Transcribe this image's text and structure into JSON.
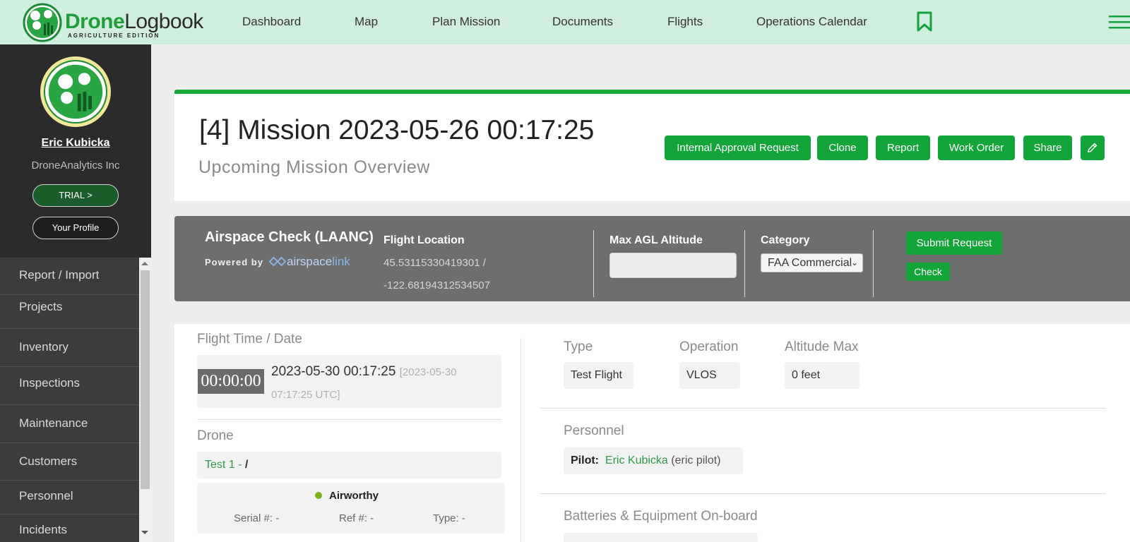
{
  "brand": {
    "name_bold": "Drone",
    "name_light": "Logbook",
    "edition": "AGRICULTURE EDITION"
  },
  "nav": {
    "dashboard": "Dashboard",
    "map": "Map",
    "plan_mission": "Plan Mission",
    "documents": "Documents",
    "flights": "Flights",
    "operations_calendar": "Operations Calendar"
  },
  "user": {
    "name": "Eric Kubicka",
    "company": "DroneAnalytics Inc",
    "trial_label": "TRIAL >",
    "profile_label": "Your Profile"
  },
  "sidebar": {
    "items": [
      {
        "label": "Report / Import"
      },
      {
        "label": "Projects"
      },
      {
        "label": "Inventory"
      },
      {
        "label": "Inspections"
      },
      {
        "label": "Maintenance"
      },
      {
        "label": "Customers"
      },
      {
        "label": "Personnel"
      },
      {
        "label": "Incidents"
      }
    ]
  },
  "mission": {
    "title": "[4] Mission 2023-05-26 00:17:25",
    "subtitle": "Upcoming Mission Overview",
    "buttons": {
      "internal_approval": "Internal Approval Request",
      "clone": "Clone",
      "report": "Report",
      "work_order": "Work Order",
      "share": "Share"
    }
  },
  "airspace": {
    "title": "Airspace Check (LAANC)",
    "powered_by": "Powered by",
    "brand_left": "airspace",
    "brand_right": "link",
    "flight_location_label": "Flight Location",
    "latitude_line": "45.53115330419301 /",
    "longitude_line": "-122.68194312534507",
    "max_agl_label": "Max AGL Altitude",
    "max_agl_value": "",
    "category_label": "Category",
    "category_value": "FAA Commercial",
    "submit_label": "Submit Request",
    "check_label": "Check"
  },
  "details": {
    "flight_time_label": "Flight Time / Date",
    "timer": "00:00:00",
    "flight_datetime": "2023-05-30 00:17:25",
    "utc_part1": "[2023-05-30",
    "utc_part2": "07:17:25 UTC]",
    "drone_label": "Drone",
    "drone_name": "Test 1 -",
    "drone_slash": "/",
    "drone_status": "Airworthy",
    "serial": "Serial #: -",
    "ref": "Ref #: -",
    "drone_type": "Type: -",
    "type_label": "Type",
    "type_value": "Test Flight",
    "operation_label": "Operation",
    "operation_value": "VLOS",
    "altitude_label": "Altitude Max",
    "altitude_value": "0 feet",
    "personnel_label": "Personnel",
    "pilot_label": "Pilot:",
    "pilot_name": "Eric Kubicka",
    "pilot_role": "(eric pilot)",
    "batteries_label": "Batteries & Equipment On-board"
  },
  "colors": {
    "accent_green": "#13a53a",
    "nav_bg": "#cfeedd",
    "sidebar_bg": "#2b2b2b",
    "airspace_bg": "#6e6e6e"
  }
}
